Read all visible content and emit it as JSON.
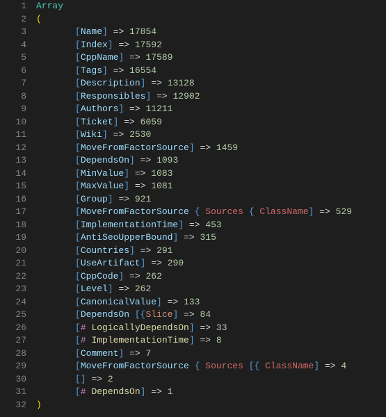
{
  "lines": [
    {
      "gutter": 1,
      "indent": 0,
      "segs": [
        {
          "cls": "kw-array",
          "t": "Array"
        }
      ]
    },
    {
      "gutter": 2,
      "indent": 0,
      "segs": [
        {
          "cls": "paren",
          "t": "("
        }
      ]
    },
    {
      "gutter": 3,
      "indent": 2,
      "segs": [
        {
          "cls": "brkt",
          "t": "["
        },
        {
          "cls": "key",
          "t": "Name"
        },
        {
          "cls": "brkt",
          "t": "]"
        },
        {
          "cls": "",
          "t": " "
        },
        {
          "cls": "arrow",
          "t": "=>"
        },
        {
          "cls": "",
          "t": " "
        },
        {
          "cls": "num",
          "t": "17854"
        }
      ]
    },
    {
      "gutter": 4,
      "indent": 2,
      "segs": [
        {
          "cls": "brkt",
          "t": "["
        },
        {
          "cls": "key",
          "t": "Index"
        },
        {
          "cls": "brkt",
          "t": "]"
        },
        {
          "cls": "",
          "t": " "
        },
        {
          "cls": "arrow",
          "t": "=>"
        },
        {
          "cls": "",
          "t": " "
        },
        {
          "cls": "num",
          "t": "17592"
        }
      ]
    },
    {
      "gutter": 5,
      "indent": 2,
      "segs": [
        {
          "cls": "brkt",
          "t": "["
        },
        {
          "cls": "key",
          "t": "CppName"
        },
        {
          "cls": "brkt",
          "t": "]"
        },
        {
          "cls": "",
          "t": " "
        },
        {
          "cls": "arrow",
          "t": "=>"
        },
        {
          "cls": "",
          "t": " "
        },
        {
          "cls": "num",
          "t": "17589"
        }
      ]
    },
    {
      "gutter": 6,
      "indent": 2,
      "segs": [
        {
          "cls": "brkt",
          "t": "["
        },
        {
          "cls": "key",
          "t": "Tags"
        },
        {
          "cls": "brkt",
          "t": "]"
        },
        {
          "cls": "",
          "t": " "
        },
        {
          "cls": "arrow",
          "t": "=>"
        },
        {
          "cls": "",
          "t": " "
        },
        {
          "cls": "num",
          "t": "16554"
        }
      ]
    },
    {
      "gutter": 7,
      "indent": 2,
      "segs": [
        {
          "cls": "brkt",
          "t": "["
        },
        {
          "cls": "key",
          "t": "Description"
        },
        {
          "cls": "brkt",
          "t": "]"
        },
        {
          "cls": "",
          "t": " "
        },
        {
          "cls": "arrow",
          "t": "=>"
        },
        {
          "cls": "",
          "t": " "
        },
        {
          "cls": "num",
          "t": "13128"
        }
      ]
    },
    {
      "gutter": 8,
      "indent": 2,
      "segs": [
        {
          "cls": "brkt",
          "t": "["
        },
        {
          "cls": "key",
          "t": "Responsibles"
        },
        {
          "cls": "brkt",
          "t": "]"
        },
        {
          "cls": "",
          "t": " "
        },
        {
          "cls": "arrow",
          "t": "=>"
        },
        {
          "cls": "",
          "t": " "
        },
        {
          "cls": "num",
          "t": "12902"
        }
      ]
    },
    {
      "gutter": 9,
      "indent": 2,
      "segs": [
        {
          "cls": "brkt",
          "t": "["
        },
        {
          "cls": "key",
          "t": "Authors"
        },
        {
          "cls": "brkt",
          "t": "]"
        },
        {
          "cls": "",
          "t": " "
        },
        {
          "cls": "arrow",
          "t": "=>"
        },
        {
          "cls": "",
          "t": " "
        },
        {
          "cls": "num",
          "t": "11211"
        }
      ]
    },
    {
      "gutter": 10,
      "indent": 2,
      "segs": [
        {
          "cls": "brkt",
          "t": "["
        },
        {
          "cls": "key",
          "t": "Ticket"
        },
        {
          "cls": "brkt",
          "t": "]"
        },
        {
          "cls": "",
          "t": " "
        },
        {
          "cls": "arrow",
          "t": "=>"
        },
        {
          "cls": "",
          "t": " "
        },
        {
          "cls": "num",
          "t": "6059"
        }
      ]
    },
    {
      "gutter": 11,
      "indent": 2,
      "segs": [
        {
          "cls": "brkt",
          "t": "["
        },
        {
          "cls": "key",
          "t": "Wiki"
        },
        {
          "cls": "brkt",
          "t": "]"
        },
        {
          "cls": "",
          "t": " "
        },
        {
          "cls": "arrow",
          "t": "=>"
        },
        {
          "cls": "",
          "t": " "
        },
        {
          "cls": "num",
          "t": "2530"
        }
      ]
    },
    {
      "gutter": 12,
      "indent": 2,
      "segs": [
        {
          "cls": "brkt",
          "t": "["
        },
        {
          "cls": "key",
          "t": "MoveFromFactorSource"
        },
        {
          "cls": "brkt",
          "t": "]"
        },
        {
          "cls": "",
          "t": " "
        },
        {
          "cls": "arrow",
          "t": "=>"
        },
        {
          "cls": "",
          "t": " "
        },
        {
          "cls": "num",
          "t": "1459"
        }
      ]
    },
    {
      "gutter": 13,
      "indent": 2,
      "segs": [
        {
          "cls": "brkt",
          "t": "["
        },
        {
          "cls": "key",
          "t": "DependsOn"
        },
        {
          "cls": "brkt",
          "t": "]"
        },
        {
          "cls": "",
          "t": " "
        },
        {
          "cls": "arrow",
          "t": "=>"
        },
        {
          "cls": "",
          "t": " "
        },
        {
          "cls": "num",
          "t": "1093"
        }
      ]
    },
    {
      "gutter": 14,
      "indent": 2,
      "segs": [
        {
          "cls": "brkt",
          "t": "["
        },
        {
          "cls": "key",
          "t": "MinValue"
        },
        {
          "cls": "brkt",
          "t": "]"
        },
        {
          "cls": "",
          "t": " "
        },
        {
          "cls": "arrow",
          "t": "=>"
        },
        {
          "cls": "",
          "t": " "
        },
        {
          "cls": "num",
          "t": "1083"
        }
      ]
    },
    {
      "gutter": 15,
      "indent": 2,
      "segs": [
        {
          "cls": "brkt",
          "t": "["
        },
        {
          "cls": "key",
          "t": "MaxValue"
        },
        {
          "cls": "brkt",
          "t": "]"
        },
        {
          "cls": "",
          "t": " "
        },
        {
          "cls": "arrow",
          "t": "=>"
        },
        {
          "cls": "",
          "t": " "
        },
        {
          "cls": "num",
          "t": "1081"
        }
      ]
    },
    {
      "gutter": 16,
      "indent": 2,
      "segs": [
        {
          "cls": "brkt",
          "t": "["
        },
        {
          "cls": "key",
          "t": "Group"
        },
        {
          "cls": "brkt",
          "t": "]"
        },
        {
          "cls": "",
          "t": " "
        },
        {
          "cls": "arrow",
          "t": "=>"
        },
        {
          "cls": "",
          "t": " "
        },
        {
          "cls": "num",
          "t": "921"
        }
      ]
    },
    {
      "gutter": 17,
      "indent": 2,
      "segs": [
        {
          "cls": "brkt",
          "t": "["
        },
        {
          "cls": "key",
          "t": "MoveFromFactorSource"
        },
        {
          "cls": "",
          "t": " "
        },
        {
          "cls": "brace",
          "t": "{"
        },
        {
          "cls": "",
          "t": " "
        },
        {
          "cls": "word-sources",
          "t": "Sources"
        },
        {
          "cls": "",
          "t": " "
        },
        {
          "cls": "brace",
          "t": "{"
        },
        {
          "cls": "",
          "t": " "
        },
        {
          "cls": "word-classname",
          "t": "ClassName"
        },
        {
          "cls": "brkt",
          "t": "]"
        },
        {
          "cls": "",
          "t": " "
        },
        {
          "cls": "arrow",
          "t": "=>"
        },
        {
          "cls": "",
          "t": " "
        },
        {
          "cls": "num",
          "t": "529"
        }
      ]
    },
    {
      "gutter": 18,
      "indent": 2,
      "segs": [
        {
          "cls": "brkt",
          "t": "["
        },
        {
          "cls": "key",
          "t": "ImplementationTime"
        },
        {
          "cls": "brkt",
          "t": "]"
        },
        {
          "cls": "",
          "t": " "
        },
        {
          "cls": "arrow",
          "t": "=>"
        },
        {
          "cls": "",
          "t": " "
        },
        {
          "cls": "num",
          "t": "453"
        }
      ]
    },
    {
      "gutter": 19,
      "indent": 2,
      "segs": [
        {
          "cls": "brkt",
          "t": "["
        },
        {
          "cls": "key",
          "t": "AntiSeoUpperBound"
        },
        {
          "cls": "brkt",
          "t": "]"
        },
        {
          "cls": "",
          "t": " "
        },
        {
          "cls": "arrow",
          "t": "=>"
        },
        {
          "cls": "",
          "t": " "
        },
        {
          "cls": "num",
          "t": "315"
        }
      ]
    },
    {
      "gutter": 20,
      "indent": 2,
      "segs": [
        {
          "cls": "brkt",
          "t": "["
        },
        {
          "cls": "key",
          "t": "Countries"
        },
        {
          "cls": "brkt",
          "t": "]"
        },
        {
          "cls": "",
          "t": " "
        },
        {
          "cls": "arrow",
          "t": "=>"
        },
        {
          "cls": "",
          "t": " "
        },
        {
          "cls": "num",
          "t": "291"
        }
      ]
    },
    {
      "gutter": 21,
      "indent": 2,
      "segs": [
        {
          "cls": "brkt",
          "t": "["
        },
        {
          "cls": "key",
          "t": "UseArtifact"
        },
        {
          "cls": "brkt",
          "t": "]"
        },
        {
          "cls": "",
          "t": " "
        },
        {
          "cls": "arrow",
          "t": "=>"
        },
        {
          "cls": "",
          "t": " "
        },
        {
          "cls": "num",
          "t": "290"
        }
      ]
    },
    {
      "gutter": 22,
      "indent": 2,
      "segs": [
        {
          "cls": "brkt",
          "t": "["
        },
        {
          "cls": "key",
          "t": "CppCode"
        },
        {
          "cls": "brkt",
          "t": "]"
        },
        {
          "cls": "",
          "t": " "
        },
        {
          "cls": "arrow",
          "t": "=>"
        },
        {
          "cls": "",
          "t": " "
        },
        {
          "cls": "num",
          "t": "262"
        }
      ]
    },
    {
      "gutter": 23,
      "indent": 2,
      "segs": [
        {
          "cls": "brkt",
          "t": "["
        },
        {
          "cls": "key",
          "t": "Level"
        },
        {
          "cls": "brkt",
          "t": "]"
        },
        {
          "cls": "",
          "t": " "
        },
        {
          "cls": "arrow",
          "t": "=>"
        },
        {
          "cls": "",
          "t": " "
        },
        {
          "cls": "num",
          "t": "262"
        }
      ]
    },
    {
      "gutter": 24,
      "indent": 2,
      "segs": [
        {
          "cls": "brkt",
          "t": "["
        },
        {
          "cls": "key",
          "t": "CanonicalValue"
        },
        {
          "cls": "brkt",
          "t": "]"
        },
        {
          "cls": "",
          "t": " "
        },
        {
          "cls": "arrow",
          "t": "=>"
        },
        {
          "cls": "",
          "t": " "
        },
        {
          "cls": "num",
          "t": "133"
        }
      ]
    },
    {
      "gutter": 25,
      "indent": 2,
      "segs": [
        {
          "cls": "brkt",
          "t": "["
        },
        {
          "cls": "key",
          "t": "DependsOn"
        },
        {
          "cls": "",
          "t": " "
        },
        {
          "cls": "brkt",
          "t": "["
        },
        {
          "cls": "brace",
          "t": "{"
        },
        {
          "cls": "slice",
          "t": "Slice"
        },
        {
          "cls": "brkt",
          "t": "]"
        },
        {
          "cls": "",
          "t": " "
        },
        {
          "cls": "arrow",
          "t": "=>"
        },
        {
          "cls": "",
          "t": " "
        },
        {
          "cls": "num",
          "t": "84"
        }
      ]
    },
    {
      "gutter": 26,
      "indent": 2,
      "segs": [
        {
          "cls": "brkt",
          "t": "["
        },
        {
          "cls": "hash",
          "t": "#"
        },
        {
          "cls": "",
          "t": " "
        },
        {
          "cls": "depword",
          "t": "LogicallyDependsOn"
        },
        {
          "cls": "brkt",
          "t": "]"
        },
        {
          "cls": "",
          "t": " "
        },
        {
          "cls": "arrow",
          "t": "=>"
        },
        {
          "cls": "",
          "t": " "
        },
        {
          "cls": "num",
          "t": "33"
        }
      ]
    },
    {
      "gutter": 27,
      "indent": 2,
      "segs": [
        {
          "cls": "brkt",
          "t": "["
        },
        {
          "cls": "hash",
          "t": "#"
        },
        {
          "cls": "",
          "t": " "
        },
        {
          "cls": "depword",
          "t": "ImplementationTime"
        },
        {
          "cls": "brkt",
          "t": "]"
        },
        {
          "cls": "",
          "t": " "
        },
        {
          "cls": "arrow",
          "t": "=>"
        },
        {
          "cls": "",
          "t": " "
        },
        {
          "cls": "num",
          "t": "8"
        }
      ]
    },
    {
      "gutter": 28,
      "indent": 2,
      "segs": [
        {
          "cls": "brkt",
          "t": "["
        },
        {
          "cls": "key",
          "t": "Comment"
        },
        {
          "cls": "brkt",
          "t": "]"
        },
        {
          "cls": "",
          "t": " "
        },
        {
          "cls": "arrow",
          "t": "=>"
        },
        {
          "cls": "",
          "t": " "
        },
        {
          "cls": "num",
          "t": "7"
        }
      ]
    },
    {
      "gutter": 29,
      "indent": 2,
      "segs": [
        {
          "cls": "brkt",
          "t": "["
        },
        {
          "cls": "key",
          "t": "MoveFromFactorSource"
        },
        {
          "cls": "",
          "t": " "
        },
        {
          "cls": "brace",
          "t": "{"
        },
        {
          "cls": "",
          "t": " "
        },
        {
          "cls": "word-sources",
          "t": "Sources"
        },
        {
          "cls": "",
          "t": " "
        },
        {
          "cls": "brkt",
          "t": "["
        },
        {
          "cls": "brace",
          "t": "{"
        },
        {
          "cls": "",
          "t": " "
        },
        {
          "cls": "word-classname",
          "t": "ClassName"
        },
        {
          "cls": "brkt",
          "t": "]"
        },
        {
          "cls": "",
          "t": " "
        },
        {
          "cls": "arrow",
          "t": "=>"
        },
        {
          "cls": "",
          "t": " "
        },
        {
          "cls": "num",
          "t": "4"
        }
      ]
    },
    {
      "gutter": 30,
      "indent": 2,
      "segs": [
        {
          "cls": "brkt",
          "t": "["
        },
        {
          "cls": "brkt",
          "t": "]"
        },
        {
          "cls": "",
          "t": " "
        },
        {
          "cls": "arrow",
          "t": "=>"
        },
        {
          "cls": "",
          "t": " "
        },
        {
          "cls": "num",
          "t": "2"
        }
      ]
    },
    {
      "gutter": 31,
      "indent": 2,
      "segs": [
        {
          "cls": "brkt",
          "t": "["
        },
        {
          "cls": "hash",
          "t": "#"
        },
        {
          "cls": "",
          "t": " "
        },
        {
          "cls": "depword",
          "t": "DependsOn"
        },
        {
          "cls": "brkt",
          "t": "]"
        },
        {
          "cls": "",
          "t": " "
        },
        {
          "cls": "arrow",
          "t": "=>"
        },
        {
          "cls": "",
          "t": " "
        },
        {
          "cls": "num",
          "t": "1"
        }
      ]
    },
    {
      "gutter": 32,
      "indent": 0,
      "segs": [
        {
          "cls": "paren",
          "t": ")"
        }
      ]
    }
  ]
}
